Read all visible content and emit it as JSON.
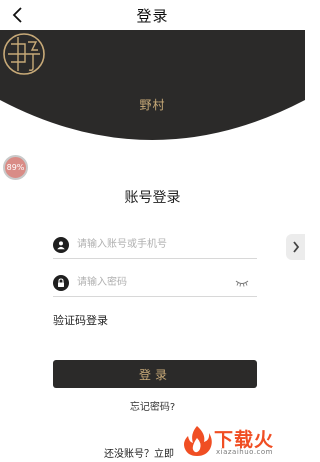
{
  "header": {
    "title": "登录",
    "back_icon": "chevron-left-icon"
  },
  "brand": {
    "name": "野村",
    "logo_icon": "brand-logo-icon",
    "color": "#c8aa78"
  },
  "hero": {
    "background": "#2b2a29"
  },
  "progress_badge": {
    "text": "89%"
  },
  "login": {
    "title": "账号登录",
    "account_placeholder": "请输入账号或手机号",
    "password_placeholder": "请输入密码",
    "sms_login": "验证码登录",
    "submit": "登录",
    "forgot": "忘记密码?",
    "register": "还没账号？立即"
  },
  "watermark": {
    "text": "下载火",
    "subtext": "xiazaihuo.com",
    "color": "#f04e23"
  }
}
